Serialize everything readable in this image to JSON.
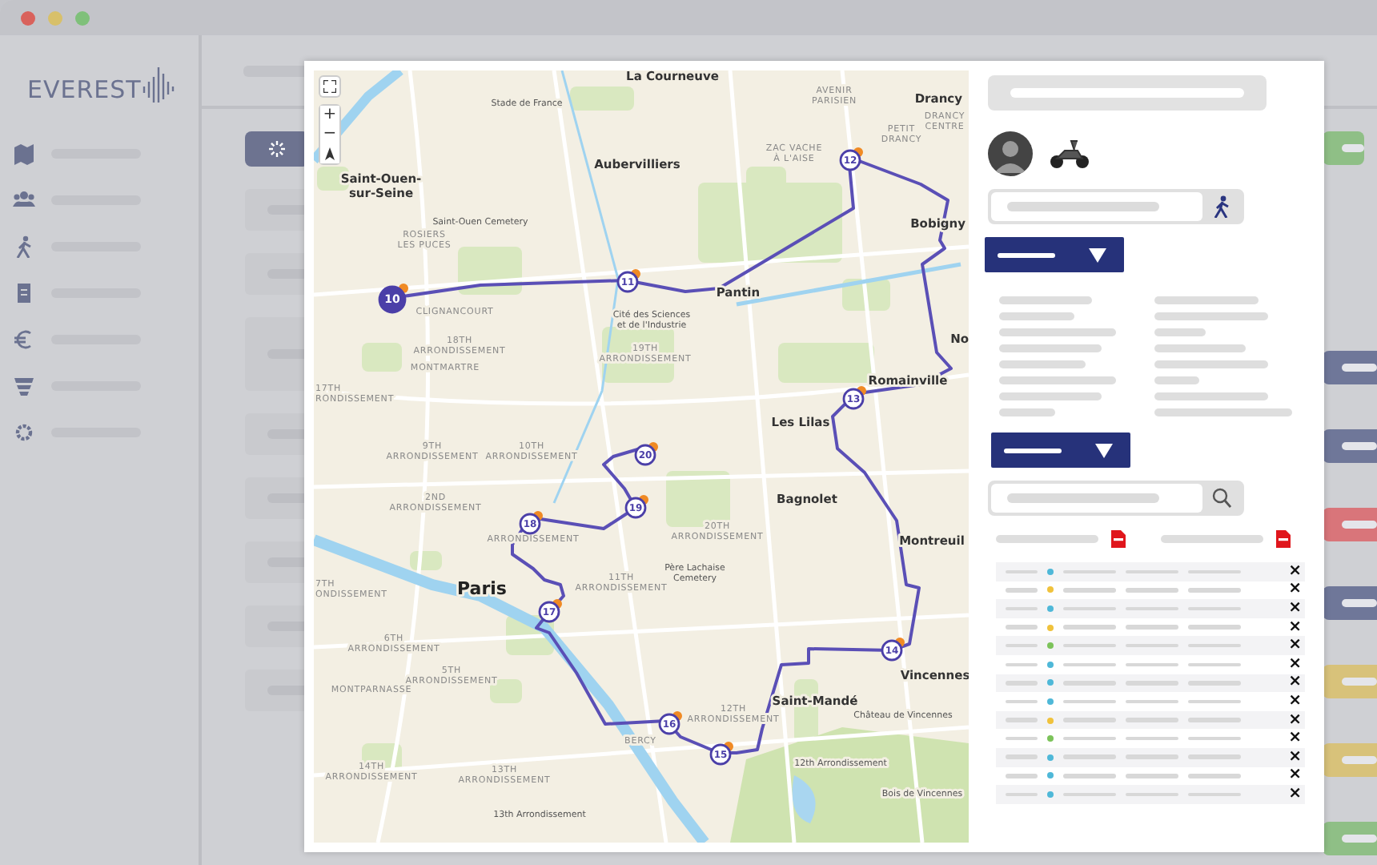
{
  "app": {
    "logo": "EVEREST"
  },
  "status_tags": [
    {
      "color": "#8fbf86"
    },
    {
      "color": "#6f7799"
    },
    {
      "color": "#6f7799"
    },
    {
      "color": "#d9757a"
    },
    {
      "color": "#6f7799"
    },
    {
      "color": "#d8c27a"
    },
    {
      "color": "#d8c27a"
    },
    {
      "color": "#8fbf86"
    }
  ],
  "map": {
    "zoom_controls": [
      "+",
      "−"
    ],
    "labels": [
      {
        "kind": "city",
        "lines": [
          "La Courneuve"
        ]
      },
      {
        "kind": "poi",
        "lines": [
          "Stade de France"
        ]
      },
      {
        "kind": "district",
        "lines": [
          "AVENIR",
          "PARISIEN"
        ]
      },
      {
        "kind": "city",
        "lines": [
          "Drancy"
        ]
      },
      {
        "kind": "district",
        "lines": [
          "DRANCY",
          "CENTRE"
        ]
      },
      {
        "kind": "district",
        "lines": [
          "PETIT",
          "DRANCY"
        ]
      },
      {
        "kind": "city",
        "lines": [
          "Aubervilliers"
        ]
      },
      {
        "kind": "district",
        "lines": [
          "ZAC VACHE",
          "À L'AISE"
        ]
      },
      {
        "kind": "city",
        "lines": [
          "Saint-Ouen-",
          "sur-Seine"
        ]
      },
      {
        "kind": "poi",
        "lines": [
          "Saint-Ouen Cemetery"
        ]
      },
      {
        "kind": "district",
        "lines": [
          "ROSIERS",
          "LES PUCES"
        ]
      },
      {
        "kind": "city",
        "lines": [
          "Bobigny"
        ]
      },
      {
        "kind": "city",
        "lines": [
          "Pantin"
        ]
      },
      {
        "kind": "district",
        "lines": [
          "CLIGNANCOURT"
        ]
      },
      {
        "kind": "poi",
        "lines": [
          "Cité des Sciences",
          "et de l'Industrie"
        ]
      },
      {
        "kind": "city",
        "lines": [
          "No"
        ]
      },
      {
        "kind": "district",
        "lines": [
          "18TH",
          "ARRONDISSEMENT"
        ]
      },
      {
        "kind": "district",
        "lines": [
          "19TH",
          "ARRONDISSEMENT"
        ]
      },
      {
        "kind": "district",
        "lines": [
          "MONTMARTRE"
        ]
      },
      {
        "kind": "district",
        "lines": [
          "17TH",
          "RONDISSEMENT"
        ]
      },
      {
        "kind": "city",
        "lines": [
          "Romainville"
        ]
      },
      {
        "kind": "city",
        "lines": [
          "Les Lilas"
        ]
      },
      {
        "kind": "district",
        "lines": [
          "9TH",
          "ARRONDISSEMENT"
        ]
      },
      {
        "kind": "district",
        "lines": [
          "10TH",
          "ARRONDISSEMENT"
        ]
      },
      {
        "kind": "district",
        "lines": [
          "2ND",
          "ARRONDISSEMENT"
        ]
      },
      {
        "kind": "district",
        "lines": [
          "ARRONDISSEMENT"
        ]
      },
      {
        "kind": "district",
        "lines": [
          "20TH",
          "ARRONDISSEMENT"
        ]
      },
      {
        "kind": "city",
        "lines": [
          "Bagnolet"
        ]
      },
      {
        "kind": "poi",
        "lines": [
          "Père Lachaise",
          "Cemetery"
        ]
      },
      {
        "kind": "city",
        "lines": [
          "Montreuil"
        ]
      },
      {
        "kind": "capital",
        "lines": [
          "Paris"
        ]
      },
      {
        "kind": "district",
        "lines": [
          "11TH",
          "ARRONDISSEMENT"
        ]
      },
      {
        "kind": "district",
        "lines": [
          "7TH",
          "ONDISSEMENT"
        ]
      },
      {
        "kind": "district",
        "lines": [
          "6TH",
          "ARRONDISSEMENT"
        ]
      },
      {
        "kind": "district",
        "lines": [
          "5TH",
          "ARRONDISSEMENT"
        ]
      },
      {
        "kind": "district",
        "lines": [
          "MONTPARNASSE"
        ]
      },
      {
        "kind": "city",
        "lines": [
          "Vincennes"
        ]
      },
      {
        "kind": "city",
        "lines": [
          "Saint-Mandé"
        ]
      },
      {
        "kind": "district",
        "lines": [
          "12TH",
          "ARRONDISSEMENT"
        ]
      },
      {
        "kind": "poi",
        "lines": [
          "Château de Vincennes"
        ]
      },
      {
        "kind": "district",
        "lines": [
          "BERCY"
        ]
      },
      {
        "kind": "poi",
        "lines": [
          "12th Arrondissement"
        ]
      },
      {
        "kind": "district",
        "lines": [
          "14TH",
          "ARRONDISSEMENT"
        ]
      },
      {
        "kind": "district",
        "lines": [
          "13TH",
          "ARRONDISSEMENT"
        ]
      },
      {
        "kind": "poi",
        "lines": [
          "Bois de Vincennes"
        ]
      },
      {
        "kind": "poi",
        "lines": [
          "13th Arrondissement"
        ]
      }
    ],
    "stops": [
      {
        "number": "10",
        "selected": true
      },
      {
        "number": "11",
        "selected": false
      },
      {
        "number": "12",
        "selected": false
      },
      {
        "number": "13",
        "selected": false
      },
      {
        "number": "14",
        "selected": false
      },
      {
        "number": "15",
        "selected": false
      },
      {
        "number": "16",
        "selected": false
      },
      {
        "number": "17",
        "selected": false
      },
      {
        "number": "18",
        "selected": false
      },
      {
        "number": "19",
        "selected": false
      },
      {
        "number": "20",
        "selected": false
      }
    ]
  },
  "deliveries": [
    {
      "color": "#4fb8d8",
      "action": "×"
    },
    {
      "color": "#f0c23c",
      "action": "×"
    },
    {
      "color": "#4fb8d8",
      "action": "×"
    },
    {
      "color": "#f0c23c",
      "action": "×"
    },
    {
      "color": "#7cc35a",
      "action": "×"
    },
    {
      "color": "#4fb8d8",
      "action": "×"
    },
    {
      "color": "#4fb8d8",
      "action": "×"
    },
    {
      "color": "#4fb8d8",
      "action": "×"
    },
    {
      "color": "#f0c23c",
      "action": "×"
    },
    {
      "color": "#7cc35a",
      "action": "×"
    },
    {
      "color": "#4fb8d8",
      "action": "×"
    },
    {
      "color": "#4fb8d8",
      "action": "×"
    },
    {
      "color": "#4fb8d8",
      "action": "×"
    }
  ]
}
